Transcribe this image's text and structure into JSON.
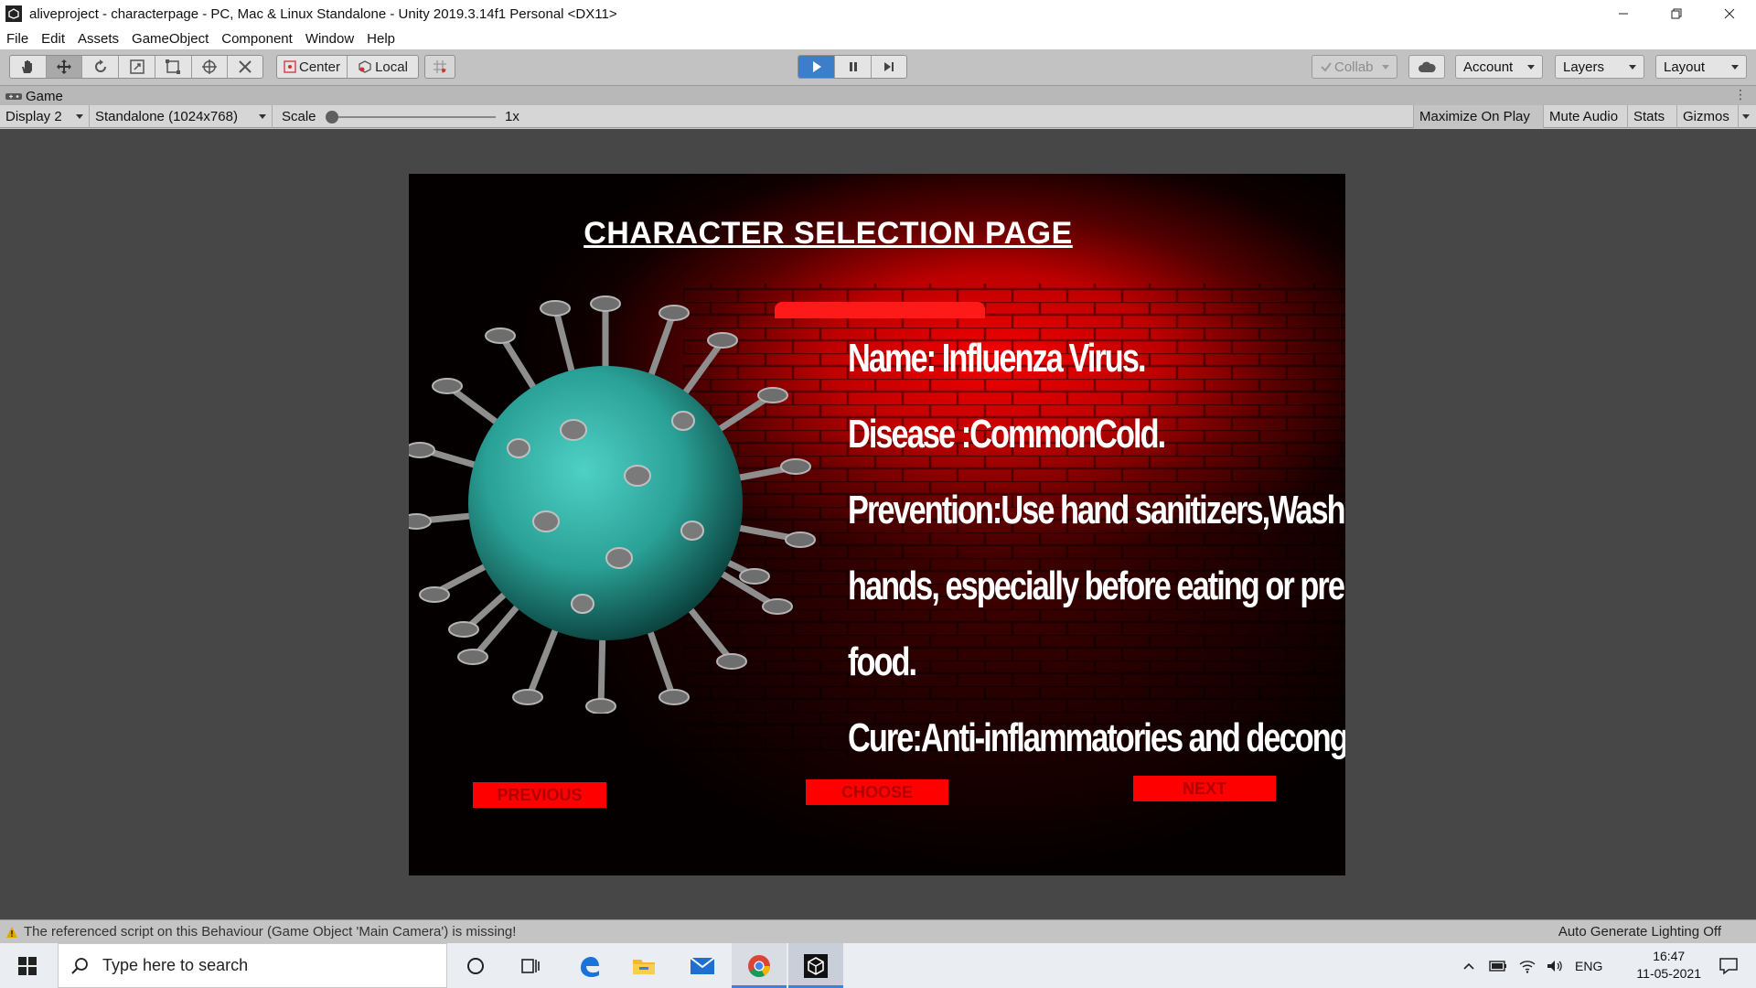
{
  "window": {
    "title": "aliveproject - characterpage - PC, Mac & Linux Standalone - Unity 2019.3.14f1 Personal <DX11>",
    "controls": [
      "minimize",
      "maximize",
      "close"
    ]
  },
  "menu": [
    "File",
    "Edit",
    "Assets",
    "GameObject",
    "Component",
    "Window",
    "Help"
  ],
  "toolbar": {
    "tools": [
      "hand-tool",
      "move-tool",
      "rotate-tool",
      "scale-tool",
      "rect-tool",
      "transform-tool",
      "custom-tool"
    ],
    "pivot_label": "Center",
    "space_label": "Local",
    "collab_label": "Collab",
    "account_label": "Account",
    "layers_label": "Layers",
    "layout_label": "Layout"
  },
  "game_tab": {
    "label": "Game"
  },
  "game_toolbar": {
    "display": "Display 2",
    "resolution": "Standalone (1024x768)",
    "scale_label": "Scale",
    "scale_value": "1x",
    "maximize_on_play": "Maximize On Play",
    "mute_audio": "Mute Audio",
    "stats": "Stats",
    "gizmos": "Gizmos"
  },
  "game": {
    "title": "CHARACTER SELECTION PAGE",
    "info": {
      "name": "Name: Influenza Virus.",
      "disease": "Disease :CommonCold.",
      "prevention_1": "Prevention:Use hand sanitizers,Wash your",
      "prevention_2": "hands, especially before eating or preparing",
      "prevention_3": "food.",
      "cure": "Cure:Anti-inflammatories and decongestants"
    },
    "buttons": {
      "previous": "PREVIOUS",
      "choose": "CHOOSE",
      "next": "NEXT"
    },
    "colors": {
      "button_bg": "#ff0000",
      "button_text": "#b00000",
      "virus_body": "#2fa39a",
      "wall_glow": "#ff0000"
    }
  },
  "status": {
    "warning": "The referenced script on this Behaviour (Game Object 'Main Camera') is missing!",
    "lighting": "Auto Generate Lighting Off"
  },
  "taskbar": {
    "search_placeholder": "Type here to search",
    "apps": [
      "cortana-icon",
      "task-view-icon",
      "edge-icon",
      "file-explorer-icon",
      "mail-icon",
      "chrome-icon",
      "unity-icon"
    ],
    "language": "ENG",
    "time": "16:47",
    "date": "11-05-2021"
  }
}
